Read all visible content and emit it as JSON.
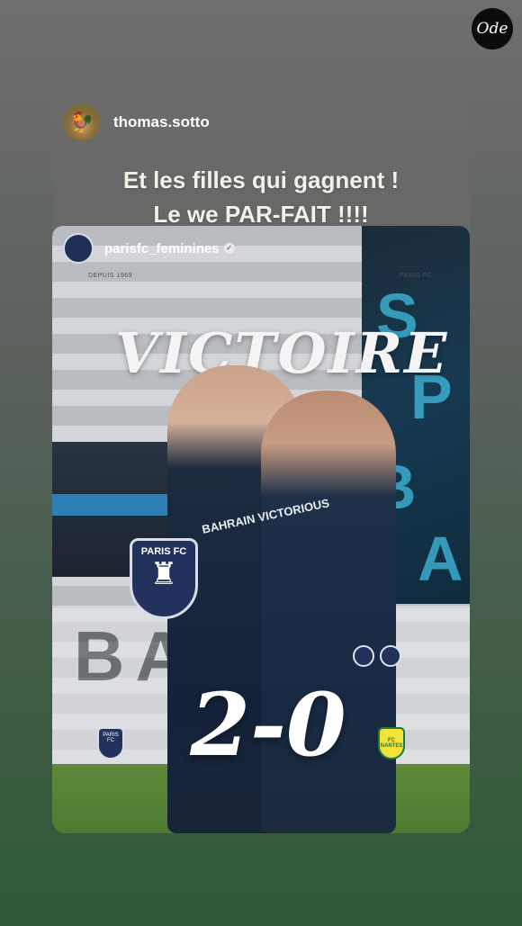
{
  "brand": {
    "logo_text": "Ode"
  },
  "story": {
    "avatar_icon": "rooster-icon",
    "username": "thomas.sotto",
    "caption_line1": "Et les filles qui gagnent !",
    "caption_line2": "Le we PAR-FAIT !!!!"
  },
  "post": {
    "account_name": "parisfc_feminines",
    "verified_icon": "verified-check-icon",
    "small_left": "DEPUIS 1969",
    "small_right": "PARIS FC",
    "headline": "VICTOIRE",
    "jersey_text": "BAHRAIN VICTORIOUS",
    "crest_label": "PARIS FC",
    "score": "2-0",
    "banner_text": "BA",
    "away_team_label": "FC NANTES",
    "colors": {
      "accent": "#2e7fb5",
      "navy": "#22325c",
      "away": "#f2e23a"
    }
  }
}
